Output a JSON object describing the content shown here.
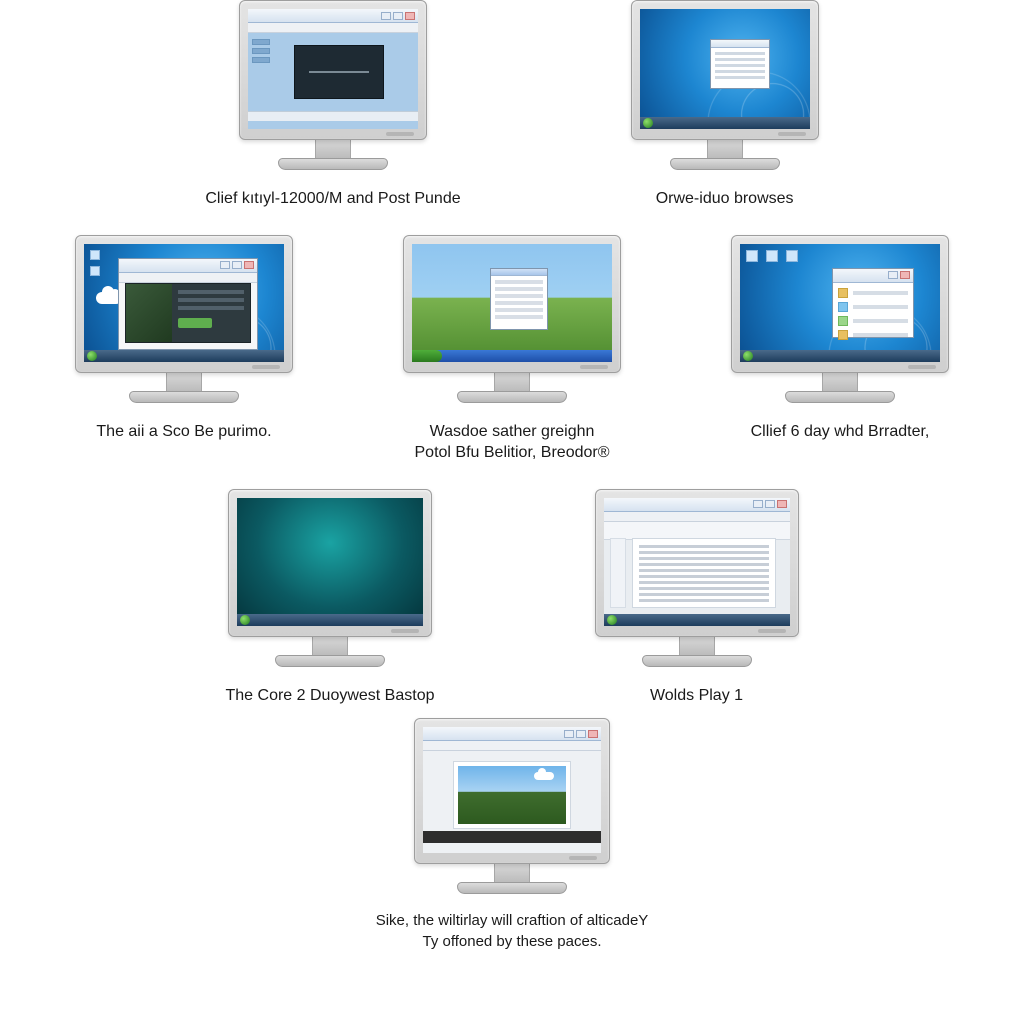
{
  "items": [
    {
      "caption": "Clief kıtıyl-12000/M and Post Punde"
    },
    {
      "caption": "Orwe-iduo browses"
    },
    {
      "caption": "The aii a Sco Be purimo."
    },
    {
      "caption": "Wasdoe sather greighn\nPotol Bfu Belitior, Breodor®"
    },
    {
      "caption": "Cllief 6 day whd Brradter,"
    },
    {
      "caption": "The Core 2 Duoywest Bastop"
    },
    {
      "caption": "Wolds Play 1"
    }
  ],
  "footer": {
    "line1": "Sike, the wiltirlay will craftion of alticadeY",
    "line2": "Ty offoned by these paces."
  }
}
